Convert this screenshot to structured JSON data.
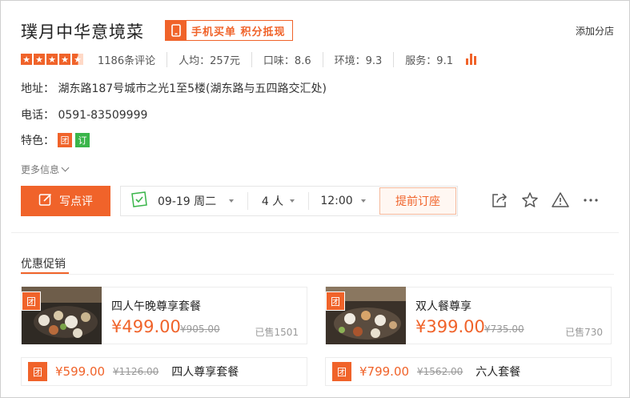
{
  "shop": {
    "title": "璞月中华意境菜",
    "promo_badge": "手机买单 积分抵现",
    "add_branch": "添加分店"
  },
  "stats": {
    "rating_stars": 4.5,
    "reviews": "1186条评论",
    "avg_price": "人均：257元",
    "taste": "口味：8.6",
    "environment": "环境：9.3",
    "service": "服务：9.1"
  },
  "info": {
    "address": "地址： 湖东路187号城市之光1至5楼(湖东路与五四路交汇处)",
    "phone": "电话： 0591-83509999",
    "features_label": "特色：",
    "tag_tuan": "团",
    "tag_ding": "订",
    "more_info": "更多信息"
  },
  "actions": {
    "write_review": "写点评",
    "date": "09-19 周二",
    "people": "4 人",
    "time": "12:00",
    "reserve": "提前订座"
  },
  "promotions": {
    "section_title": "优惠促销",
    "deals": [
      {
        "badge": "团",
        "name": "四人午晚尊享套餐",
        "price": "¥499.00",
        "original": "¥905.00",
        "sold": "已售1501"
      },
      {
        "badge": "团",
        "name": "双人餐尊享",
        "price": "¥399.00",
        "original": "¥735.00",
        "sold": "已售730"
      }
    ],
    "mini_deals": [
      {
        "badge": "团",
        "price": "¥599.00",
        "original": "¥1126.00",
        "name": "四人尊享套餐"
      },
      {
        "badge": "团",
        "price": "¥799.00",
        "original": "¥1562.00",
        "name": "六人套餐"
      }
    ]
  },
  "colors": {
    "accent": "#f0632a",
    "green": "#3ab54a"
  }
}
